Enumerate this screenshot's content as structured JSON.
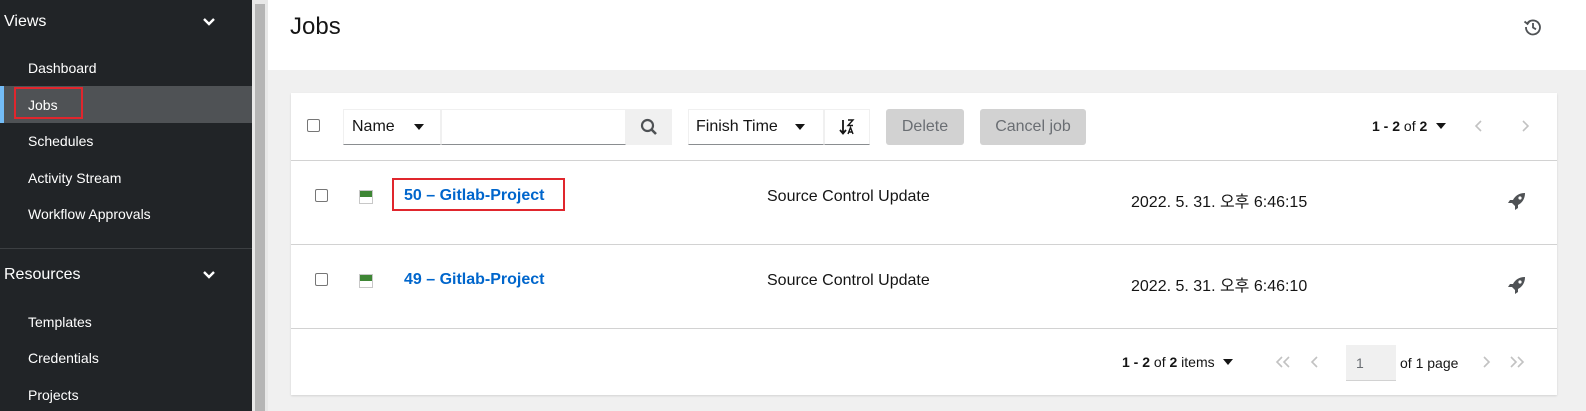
{
  "sidebar": {
    "groups": [
      {
        "label": "Views",
        "items": [
          {
            "label": "Dashboard"
          },
          {
            "label": "Jobs",
            "active": true
          },
          {
            "label": "Schedules"
          },
          {
            "label": "Activity Stream"
          },
          {
            "label": "Workflow Approvals"
          }
        ]
      },
      {
        "label": "Resources",
        "items": [
          {
            "label": "Templates"
          },
          {
            "label": "Credentials"
          },
          {
            "label": "Projects"
          }
        ]
      }
    ]
  },
  "header": {
    "title": "Jobs",
    "history_icon": "history-icon"
  },
  "toolbar": {
    "filter_select": "Name",
    "search_value": "",
    "sort_select": "Finish Time",
    "sort_icon": "sort-alpha-down-icon",
    "delete_label": "Delete",
    "cancel_label": "Cancel job",
    "pagination": {
      "range": "1 - 2",
      "of_label": "of",
      "total": "2"
    }
  },
  "jobs": [
    {
      "name": "50 – Gitlab-Project",
      "type": "Source Control Update",
      "finished": "2022. 5. 31. 오후 6:46:15",
      "status": "successful"
    },
    {
      "name": "49 – Gitlab-Project",
      "type": "Source Control Update",
      "finished": "2022. 5. 31. 오후 6:46:10",
      "status": "successful"
    }
  ],
  "footer": {
    "range": "1 - 2",
    "of_label": "of",
    "total": "2",
    "items_label": "items",
    "page_value": "1",
    "of_page_label": "of 1 page"
  },
  "colors": {
    "sidebar_bg": "#212427",
    "active_border": "#73bcf7",
    "link": "#0066cc",
    "success": "#3e8635",
    "highlight": "#e0262d"
  }
}
